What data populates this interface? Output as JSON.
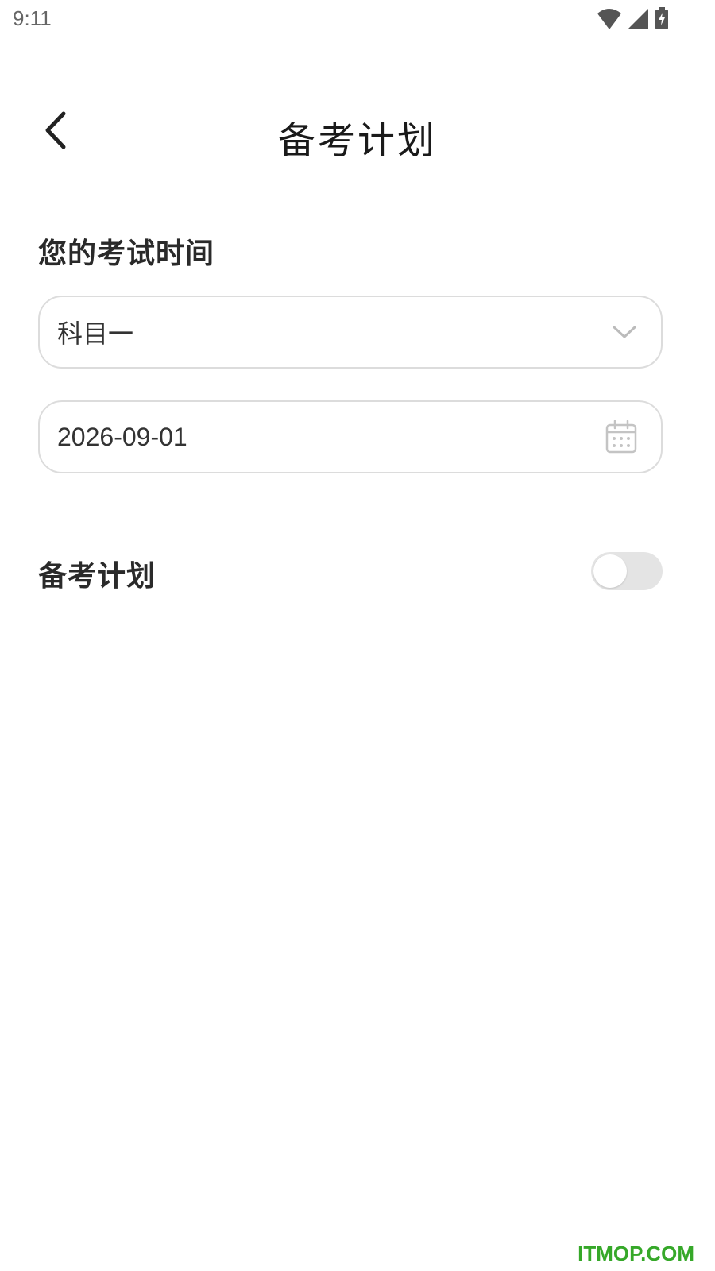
{
  "status_bar": {
    "time": "9:11",
    "icons": [
      "wifi-icon",
      "signal-icon",
      "battery-charging-icon"
    ]
  },
  "header": {
    "title": "备考计划",
    "back_icon": "chevron-left-icon"
  },
  "exam_time": {
    "section_title": "您的考试时间",
    "subject_select": {
      "value": "科目一",
      "icon": "chevron-down-icon"
    },
    "date_field": {
      "value": "2026-09-01",
      "icon": "calendar-icon"
    }
  },
  "plan": {
    "label": "备考计划",
    "toggle_on": false
  },
  "watermark": "ITMOP.COM",
  "colors": {
    "field_border": "#dcdcdc",
    "toggle_track": "#e4e4e4",
    "watermark": "#36a829"
  }
}
